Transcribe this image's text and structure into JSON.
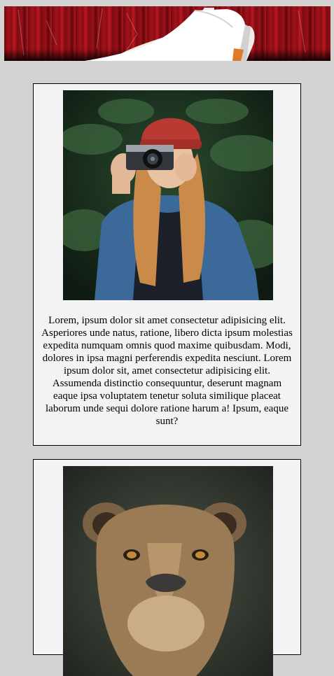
{
  "banner": {
    "image": "red-high-heel-shoes-banner"
  },
  "cards": [
    {
      "image": "woman-with-camera-photo",
      "text": "Lorem, ipsum dolor sit amet consectetur adipisicing elit. Asperiores unde natus, ratione, libero dicta ipsum molestias expedita numquam omnis quod maxime quibusdam. Modi, dolores in ipsa magni perferendis expedita nesciunt. Lorem ipsum dolor sit, amet consectetur adipisicing elit. Assumenda distinctio consequuntur, deserunt magnam eaque ipsa voluptatem tenetur soluta similique placeat laborum unde sequi dolore ratione harum a! Ipsum, eaque sunt?"
    },
    {
      "image": "lioness-portrait-photo"
    }
  ],
  "colors": {
    "page_background": "#d3d3d3",
    "card_background": "#f3f3f3",
    "card_border": "#000000"
  }
}
